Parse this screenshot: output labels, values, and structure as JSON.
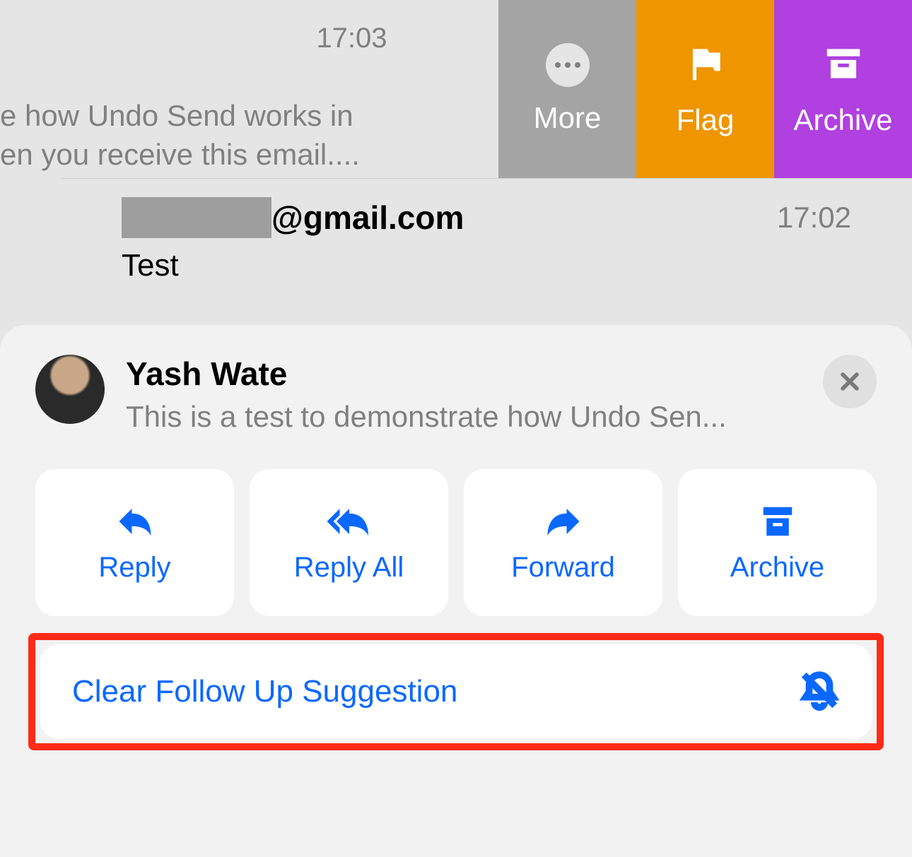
{
  "topRow": {
    "time": "17:03",
    "previewLine1": "e how Undo Send works in",
    "previewLine2": "en you receive this email....",
    "swipe": {
      "more": "More",
      "flag": "Flag",
      "archive": "Archive"
    }
  },
  "emailRow": {
    "domain": "@gmail.com",
    "time": "17:02",
    "subject": "Test"
  },
  "sheet": {
    "name": "Yash Wate",
    "snippet": "This is a test to demonstrate how Undo Sen...",
    "actions": {
      "reply": "Reply",
      "replyAll": "Reply All",
      "forward": "Forward",
      "archive": "Archive"
    },
    "clear": "Clear Follow Up Suggestion"
  }
}
